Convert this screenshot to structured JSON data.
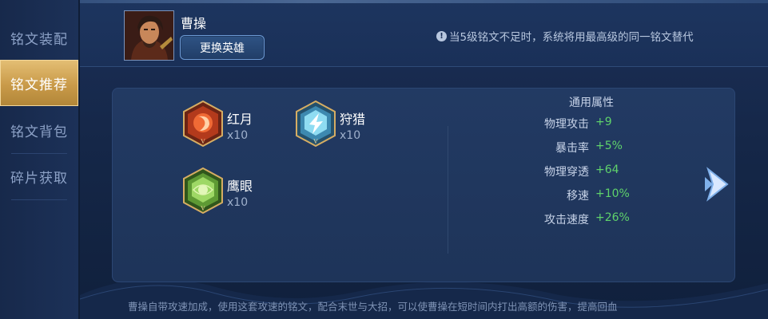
{
  "sidebar": {
    "items": [
      {
        "label": "铭文装配",
        "active": false
      },
      {
        "label": "铭文推荐",
        "active": true
      },
      {
        "label": "铭文背包",
        "active": false
      },
      {
        "label": "碎片获取",
        "active": false
      }
    ]
  },
  "hero": {
    "name": "曹操",
    "change_button": "更换英雄"
  },
  "notice": {
    "icon": "info-icon",
    "text": "当5级铭文不足时，系统将用最高级的同一铭文替代"
  },
  "runes": [
    {
      "name": "红月",
      "count": "x10",
      "color": "#d9512b",
      "icon": "red-moon-rune-icon"
    },
    {
      "name": "狩猎",
      "count": "x10",
      "color": "#62c3e8",
      "icon": "hunt-rune-icon"
    },
    {
      "name": "鹰眼",
      "count": "x10",
      "color": "#7fc24a",
      "icon": "hawk-eye-rune-icon"
    }
  ],
  "attributes": {
    "title": "通用属性",
    "rows": [
      {
        "name": "物理攻击",
        "value": "+9"
      },
      {
        "name": "暴击率",
        "value": "+5%"
      },
      {
        "name": "物理穿透",
        "value": "+64"
      },
      {
        "name": "移速",
        "value": "+10%"
      },
      {
        "name": "攻击速度",
        "value": "+26%"
      }
    ]
  },
  "next_icon": "chevron-right-icon",
  "description": "曹操自带攻速加成，使用这套攻速的铭文，配合末世与大招，可以使曹操在短时间内打出高额的伤害，提高回血",
  "colors": {
    "accent_gold": "#d6ad63",
    "value_green": "#5fd36b",
    "background": "#152748"
  }
}
